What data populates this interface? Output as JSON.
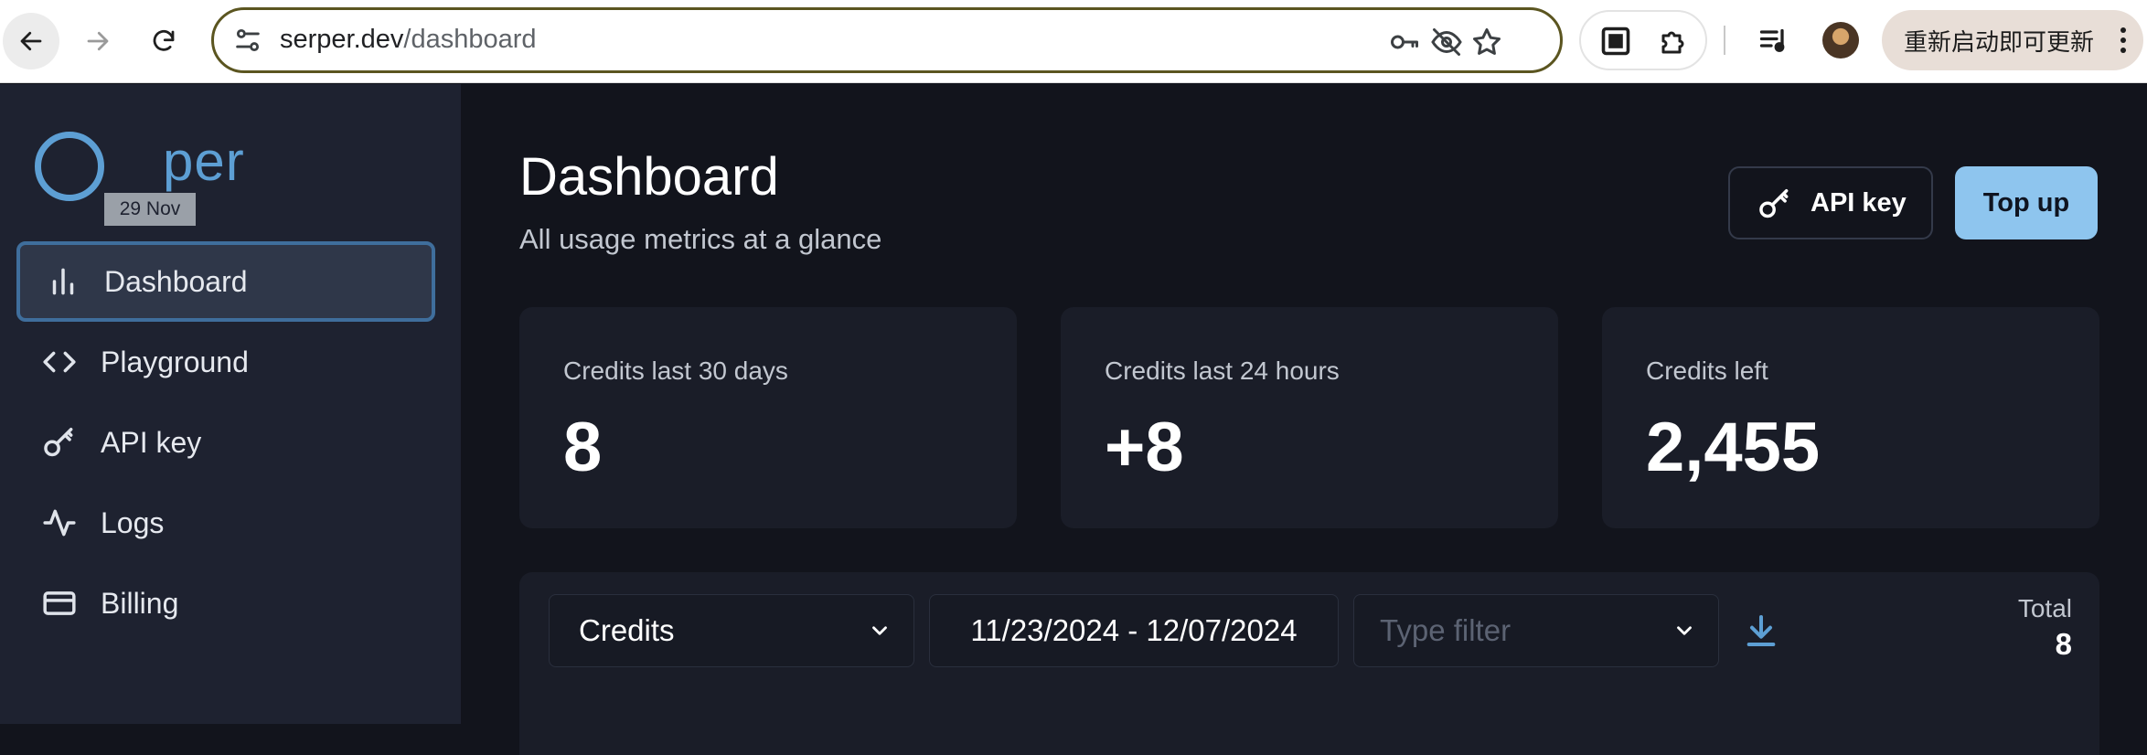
{
  "browser": {
    "url_host": "serper.dev",
    "url_path": "/dashboard",
    "update_button_label": "重新启动即可更新"
  },
  "sidebar": {
    "logo_text": "per",
    "date_badge": "29 Nov",
    "items": [
      {
        "label": "Dashboard",
        "icon": "bar-chart-icon",
        "active": true
      },
      {
        "label": "Playground",
        "icon": "code-icon",
        "active": false
      },
      {
        "label": "API key",
        "icon": "key-icon",
        "active": false
      },
      {
        "label": "Logs",
        "icon": "activity-icon",
        "active": false
      },
      {
        "label": "Billing",
        "icon": "credit-card-icon",
        "active": false
      }
    ]
  },
  "header": {
    "title": "Dashboard",
    "subtitle": "All usage metrics at a glance",
    "api_key_button": "API key",
    "top_up_button": "Top up"
  },
  "stats": [
    {
      "label": "Credits last 30 days",
      "value": "8"
    },
    {
      "label": "Credits last 24 hours",
      "value": "+8"
    },
    {
      "label": "Credits left",
      "value": "2,455"
    }
  ],
  "filters": {
    "metric_select": "Credits",
    "date_range": "11/23/2024 - 12/07/2024",
    "type_filter_placeholder": "Type filter",
    "total_label": "Total",
    "total_value": "8"
  },
  "colors": {
    "accent": "#8ec5ee",
    "logo": "#5d9fd4",
    "sidebar_bg": "#1e2230",
    "main_bg": "#12141c",
    "card_bg": "#1a1d28"
  }
}
